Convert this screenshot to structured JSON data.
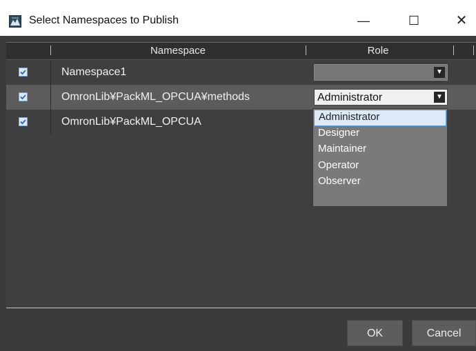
{
  "window": {
    "title": "Select Namespaces to Publish",
    "minimize_glyph": "—",
    "maximize_glyph": "☐",
    "close_glyph": "✕"
  },
  "table": {
    "columns": [
      "Namespace",
      "Role"
    ],
    "rows": [
      {
        "checked": true,
        "namespace": "Namespace1",
        "role": ""
      },
      {
        "checked": true,
        "namespace": "OmronLib¥PackML_OPCUA¥methods",
        "role": "Administrator"
      },
      {
        "checked": true,
        "namespace": "OmronLib¥PackML_OPCUA",
        "role": ""
      }
    ]
  },
  "role_dropdown": {
    "options": [
      "Administrator",
      "Designer",
      "Maintainer",
      "Operator",
      "Observer"
    ],
    "highlighted": "Administrator"
  },
  "buttons": {
    "ok": "OK",
    "cancel": "Cancel"
  },
  "colors": {
    "dialog_bg": "#3b3b3b",
    "selected_row": "#5c5c5c",
    "highlight": "#dbe9f8"
  }
}
